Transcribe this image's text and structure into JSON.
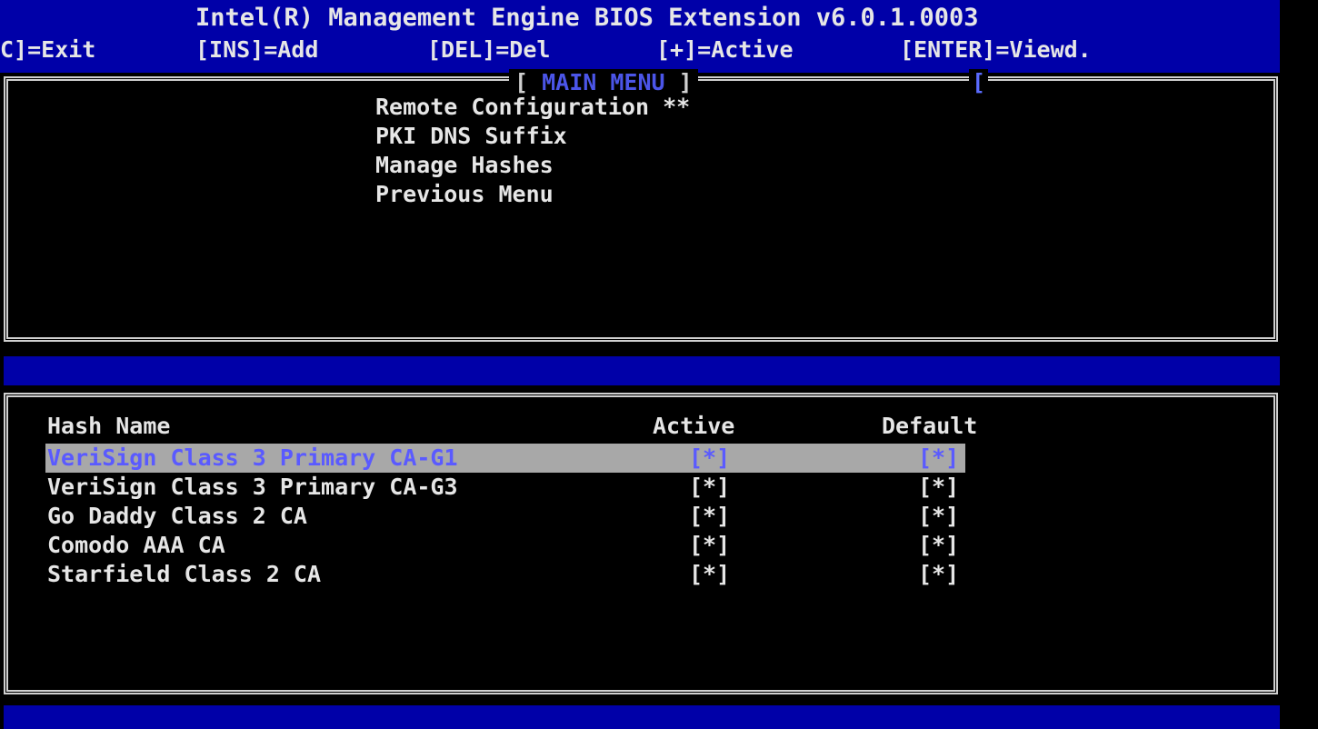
{
  "header": {
    "title": "Intel(R) Management Engine BIOS Extension v6.0.1.0003",
    "keys": [
      {
        "label": "C]=Exit"
      },
      {
        "label": "[INS]=Add"
      },
      {
        "label": "[DEL]=Del"
      },
      {
        "label": "[+]=Active"
      },
      {
        "label": "[ENTER]=Viewd."
      }
    ]
  },
  "menu": {
    "title_open": "[ ",
    "title_text": "MAIN MENU",
    "title_close": " ]",
    "marker": "[",
    "items": [
      {
        "label": "Remote Configuration **"
      },
      {
        "label": "PKI DNS Suffix"
      },
      {
        "label": "Manage Hashes"
      },
      {
        "label": "Previous Menu"
      }
    ]
  },
  "hashes": {
    "columns": {
      "name": "Hash Name",
      "active": "Active",
      "default": "Default"
    },
    "rows": [
      {
        "name": "VeriSign Class 3 Primary CA-G1",
        "active": "[*]",
        "default": "[*]",
        "selected": true
      },
      {
        "name": "VeriSign Class 3 Primary CA-G3",
        "active": "[*]",
        "default": "[*]"
      },
      {
        "name": "Go Daddy Class 2 CA",
        "active": "[*]",
        "default": "[*]"
      },
      {
        "name": "Comodo AAA CA",
        "active": "[*]",
        "default": "[*]"
      },
      {
        "name": "Starfield Class 2 CA",
        "active": "[*]",
        "default": "[*]"
      }
    ]
  },
  "colors": {
    "header_bg": "#0000a8",
    "selection_bg": "#a8a8a8",
    "selection_text": "#5a5aff",
    "text": "#e6e6e6"
  }
}
